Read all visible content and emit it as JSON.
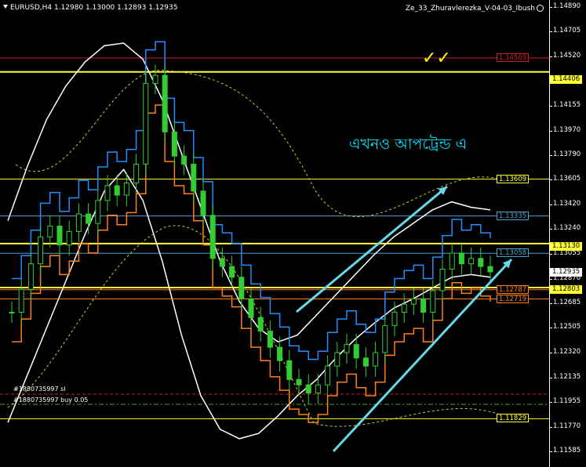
{
  "header": {
    "symbol_info": "EURUSD,H4 1.12980 1.13000 1.12893 1.12935",
    "expert_name": "Ze_33_Zhuravlerezka_V-04-03_Ibush"
  },
  "annotations": {
    "note_text": "এখনও আপট্রেন্ড এ",
    "checkmarks": "✓✓"
  },
  "orders": {
    "sl_label": "#1880735997 sl",
    "buy_label": "#1880735997 buy 0.05"
  },
  "colors": {
    "background": "#000000",
    "red_level": "#cc2222",
    "yellow_level": "#ffff33",
    "blue_level": "#4aa0d0",
    "cyan_arrow": "#66d9e8",
    "candle": "#33cc33",
    "white_band": "#ffffff",
    "orange_line": "#ff7f1a",
    "blue_line": "#1e90ff"
  },
  "chart_data": {
    "type": "line",
    "symbol": "EURUSD",
    "timeframe": "H4",
    "ohlc_header": {
      "open": 1.1298,
      "high": 1.13,
      "low": 1.12893,
      "close": 1.12935
    },
    "ylim": [
      1.1147,
      1.1494
    ],
    "y_ticks": [
      "1.14890",
      "1.14705",
      "1.14520",
      "1.14340",
      "1.14155",
      "1.13970",
      "1.13790",
      "1.13605",
      "1.13420",
      "1.13240",
      "1.13055",
      "1.12870",
      "1.12685",
      "1.12505",
      "1.12320",
      "1.12135",
      "1.11955",
      "1.11770",
      "1.11585"
    ],
    "current_price": "1.12935",
    "levels": [
      {
        "label": "1.14509",
        "value": 1.14509,
        "color": "red"
      },
      {
        "label": "1.14406",
        "value": 1.14406,
        "color": "yellow"
      },
      {
        "label": "1.13609",
        "value": 1.13609,
        "color": "yellow"
      },
      {
        "label": "1.13335",
        "value": 1.13335,
        "color": "blue"
      },
      {
        "label": "1.13130",
        "value": 1.1313,
        "color": "yellow"
      },
      {
        "label": "1.13058",
        "value": 1.13058,
        "color": "blue"
      },
      {
        "label": "1.12803",
        "value": 1.12803,
        "color": "yellow"
      },
      {
        "label": "1.12787",
        "value": 1.12787,
        "color": "orange"
      },
      {
        "label": "1.12719",
        "value": 1.12719,
        "color": "orange"
      },
      {
        "label": "1.11829",
        "value": 1.11829,
        "color": "yellow"
      }
    ],
    "price_path": [
      1.1262,
      1.1279,
      1.1298,
      1.1318,
      1.1326,
      1.1312,
      1.1322,
      1.1335,
      1.1328,
      1.1345,
      1.1356,
      1.1349,
      1.1358,
      1.1372,
      1.1432,
      1.1438,
      1.1396,
      1.1378,
      1.1372,
      1.1352,
      1.1334,
      1.1302,
      1.1296,
      1.1288,
      1.1272,
      1.1258,
      1.1248,
      1.1236,
      1.1226,
      1.1212,
      1.1208,
      1.1202,
      1.1208,
      1.1222,
      1.1232,
      1.1238,
      1.1228,
      1.1222,
      1.1232,
      1.1252,
      1.1262,
      1.1268,
      1.1272,
      1.1262,
      1.1278,
      1.1294,
      1.1306,
      1.1298,
      1.1302,
      1.1296,
      1.1292
    ],
    "band_upper": [
      1.133,
      1.137,
      1.1405,
      1.143,
      1.1448,
      1.146,
      1.1462,
      1.145,
      1.142,
      1.138,
      1.134,
      1.13,
      1.127,
      1.125,
      1.124,
      1.1245,
      1.126,
      1.1275,
      1.129,
      1.1305,
      1.1318,
      1.1328,
      1.1338,
      1.1344,
      1.134,
      1.1338
    ],
    "band_lower": [
      1.118,
      1.1215,
      1.125,
      1.1285,
      1.132,
      1.1352,
      1.1368,
      1.1345,
      1.13,
      1.1245,
      1.12,
      1.1175,
      1.1168,
      1.1172,
      1.1185,
      1.12,
      1.1212,
      1.1228,
      1.1242,
      1.1254,
      1.1265,
      1.1272,
      1.128,
      1.1288,
      1.129,
      1.1288
    ],
    "grid": false
  },
  "axis_box_labels": {
    "current": "1.12935",
    "level_12803": "1.12803",
    "level_13130": "1.13130",
    "level_14406": "1.14406"
  }
}
